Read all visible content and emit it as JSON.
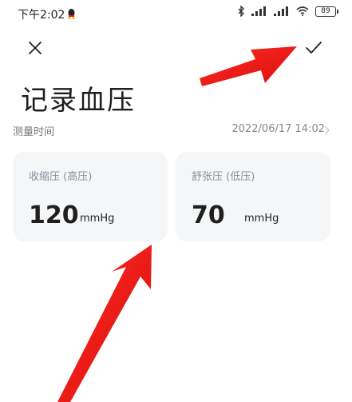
{
  "status_bar": {
    "time": "下午2:02",
    "battery": "89"
  },
  "header": {
    "title": "记录血压"
  },
  "measure_time": {
    "label": "测量时间",
    "value": "2022/06/17 14:02"
  },
  "cards": [
    {
      "label": "收缩压 (高压)",
      "value": "120",
      "unit": "mmHg"
    },
    {
      "label": "舒张压 (低压)",
      "value": "70",
      "unit": "mmHg"
    }
  ],
  "colors": {
    "card_bg": "#f5f6f8",
    "arrow": "#e8161a"
  }
}
